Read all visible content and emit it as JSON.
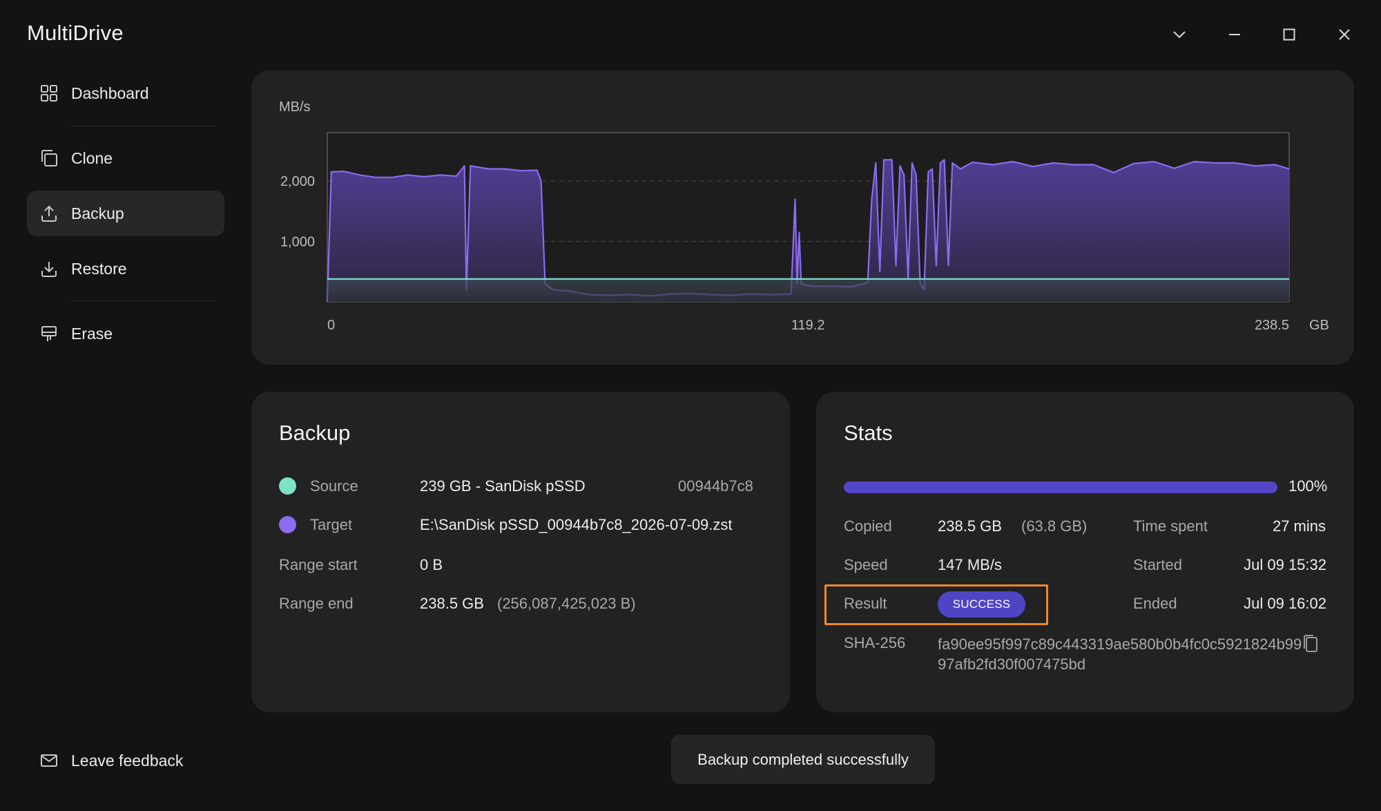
{
  "app": {
    "title": "MultiDrive"
  },
  "window_controls": [
    "chevron-down-icon",
    "minimize-icon",
    "maximize-icon",
    "close-icon"
  ],
  "sidebar": {
    "items": [
      {
        "label": "Dashboard",
        "icon": "grid-icon",
        "active": false
      },
      {
        "label": "Clone",
        "icon": "copy-icon",
        "active": false
      },
      {
        "label": "Backup",
        "icon": "upload-icon",
        "active": true
      },
      {
        "label": "Restore",
        "icon": "download-icon",
        "active": false
      },
      {
        "label": "Erase",
        "icon": "eraser-icon",
        "active": false
      }
    ],
    "feedback_label": "Leave feedback"
  },
  "chart_data": {
    "type": "area",
    "ylabel": "MB/s",
    "xlabel": "GB",
    "y_ticks": [
      "2,000",
      "1,000"
    ],
    "y_tick_values": [
      2000,
      1000
    ],
    "x_ticks": [
      "0",
      "119.2",
      "238.5"
    ],
    "x_tick_values": [
      0,
      119.2,
      238.5
    ],
    "xlim": [
      0,
      238.5
    ],
    "ylim": [
      0,
      2800
    ],
    "grid": true,
    "series": [
      {
        "color": "#8b6cf0",
        "points": [
          [
            0,
            0
          ],
          [
            1,
            2150
          ],
          [
            4,
            2160
          ],
          [
            8,
            2100
          ],
          [
            12,
            2060
          ],
          [
            16,
            2060
          ],
          [
            20,
            2100
          ],
          [
            24,
            2070
          ],
          [
            28,
            2100
          ],
          [
            32,
            2080
          ],
          [
            34,
            2250
          ],
          [
            34.5,
            200
          ],
          [
            35.5,
            2250
          ],
          [
            40,
            2200
          ],
          [
            44,
            2200
          ],
          [
            48,
            2170
          ],
          [
            52,
            2180
          ],
          [
            53,
            2000
          ],
          [
            54,
            300
          ],
          [
            56,
            200
          ],
          [
            60,
            180
          ],
          [
            65,
            120
          ],
          [
            70,
            110
          ],
          [
            75,
            120
          ],
          [
            80,
            100
          ],
          [
            85,
            130
          ],
          [
            90,
            140
          ],
          [
            95,
            120
          ],
          [
            100,
            110
          ],
          [
            105,
            130
          ],
          [
            110,
            120
          ],
          [
            115,
            130
          ],
          [
            116,
            1700
          ],
          [
            116.5,
            300
          ],
          [
            117,
            1150
          ],
          [
            117.5,
            300
          ],
          [
            120,
            260
          ],
          [
            125,
            260
          ],
          [
            130,
            250
          ],
          [
            134,
            320
          ],
          [
            135,
            1700
          ],
          [
            136,
            2300
          ],
          [
            137,
            500
          ],
          [
            138,
            2350
          ],
          [
            140,
            2350
          ],
          [
            141,
            600
          ],
          [
            142,
            2250
          ],
          [
            143,
            2100
          ],
          [
            144,
            400
          ],
          [
            145,
            2300
          ],
          [
            146,
            2100
          ],
          [
            147,
            300
          ],
          [
            148,
            200
          ],
          [
            149,
            2150
          ],
          [
            150,
            2200
          ],
          [
            151,
            600
          ],
          [
            152,
            2300
          ],
          [
            153,
            2350
          ],
          [
            154,
            600
          ],
          [
            155,
            2300
          ],
          [
            157,
            2200
          ],
          [
            160,
            2310
          ],
          [
            165,
            2270
          ],
          [
            170,
            2320
          ],
          [
            175,
            2240
          ],
          [
            180,
            2300
          ],
          [
            185,
            2270
          ],
          [
            190,
            2270
          ],
          [
            195,
            2140
          ],
          [
            200,
            2290
          ],
          [
            205,
            2320
          ],
          [
            210,
            2210
          ],
          [
            215,
            2320
          ],
          [
            220,
            2300
          ],
          [
            225,
            2300
          ],
          [
            230,
            2250
          ],
          [
            235,
            2270
          ],
          [
            238.5,
            2200
          ]
        ]
      },
      {
        "color": "#7de8d2",
        "points": [
          [
            0,
            380
          ],
          [
            238.5,
            380
          ]
        ]
      }
    ]
  },
  "backup": {
    "title": "Backup",
    "source_label": "Source",
    "source_value": "239 GB - SanDisk pSSD",
    "source_id": "00944b7c8",
    "source_color": "#7de3c6",
    "target_label": "Target",
    "target_value": "E:\\SanDisk pSSD_00944b7c8_2026-07-09.zst",
    "target_color": "#8a6cf0",
    "range_start_label": "Range start",
    "range_start_value": "0 B",
    "range_end_label": "Range end",
    "range_end_value": "238.5 GB",
    "range_end_bytes": "(256,087,425,023 B)"
  },
  "stats": {
    "title": "Stats",
    "progress_percent": 100,
    "progress_label": "100%",
    "copied_label": "Copied",
    "copied_value": "238.5 GB",
    "copied_compressed": "(63.8 GB)",
    "speed_label": "Speed",
    "speed_value": "147 MB/s",
    "result_label": "Result",
    "result_value": "SUCCESS",
    "time_spent_label": "Time spent",
    "time_spent_value": "27 mins",
    "started_label": "Started",
    "started_value": "Jul 09 15:32",
    "ended_label": "Ended",
    "ended_value": "Jul 09 16:02",
    "sha_label": "SHA-256",
    "sha_value": "fa90ee95f997c89c443319ae580b0b4fc0c5921824b9997afb2fd30f007475bd"
  },
  "toast": {
    "message": "Backup completed successfully"
  }
}
